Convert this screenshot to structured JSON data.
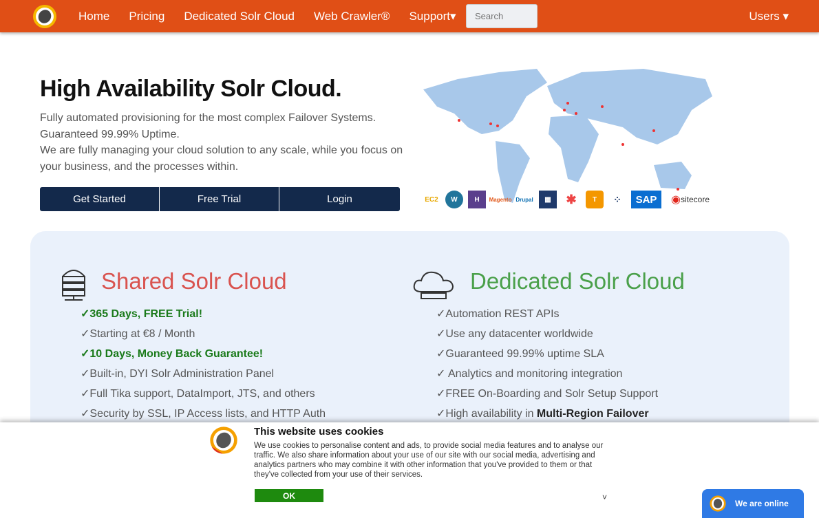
{
  "nav": {
    "items": [
      "Home",
      "Pricing",
      "Dedicated Solr Cloud",
      "Web Crawler®",
      "Support▾"
    ],
    "search_placeholder": "Search",
    "users": "Users ▾",
    "accent": "#e04f16"
  },
  "hero": {
    "title": "High Availability Solr Cloud.",
    "lines": [
      "Fully automated provisioning for the most complex Failover Systems.",
      "Guaranteed 99.99% Uptime.",
      "We are fully managing your cloud solution to any scale, while you focus on your business, and the processes within."
    ],
    "buttons": [
      "Get Started",
      "Free Trial",
      "Login"
    ],
    "logos": [
      "EC2",
      "WordPress",
      "Heroku",
      "Magento",
      "Drupal",
      "Logo",
      "Joomla",
      "TYPO3",
      "Logo",
      "SAP",
      "sitecore"
    ]
  },
  "shared": {
    "title": "Shared Solr Cloud",
    "items": [
      "✓365 Days, FREE Trial!",
      "✓Starting at €8 / Month",
      "✓10 Days, Money Back Guarantee!",
      "✓Built-in, DYI Solr Administration Panel",
      "✓Full Tika support, DataImport, JTS, and others",
      "✓Security by SSL, IP Access lists, and HTTP Auth"
    ]
  },
  "dedicated": {
    "title": "Dedicated Solr Cloud",
    "items": [
      "✓Automation REST APIs",
      "✓Use any datacenter worldwide",
      "✓Guaranteed 99.99% uptime SLA",
      "✓ Analytics and monitoring integration",
      "✓FREE On-Boarding and Solr Setup Support"
    ],
    "last_prefix": "✓High availability in ",
    "last_bold": "Multi-Region Failover"
  },
  "cookie": {
    "title": "This website uses cookies",
    "text": "We use cookies to personalise content and ads, to provide social media features and to analyse our traffic. We also share information about your use of our site with our social media, advertising and analytics partners who may combine it with other information that you've provided to them or that they've collected from your use of their services.",
    "ok": "OK",
    "chevron": "˅"
  },
  "chat": {
    "label": "We are online"
  }
}
